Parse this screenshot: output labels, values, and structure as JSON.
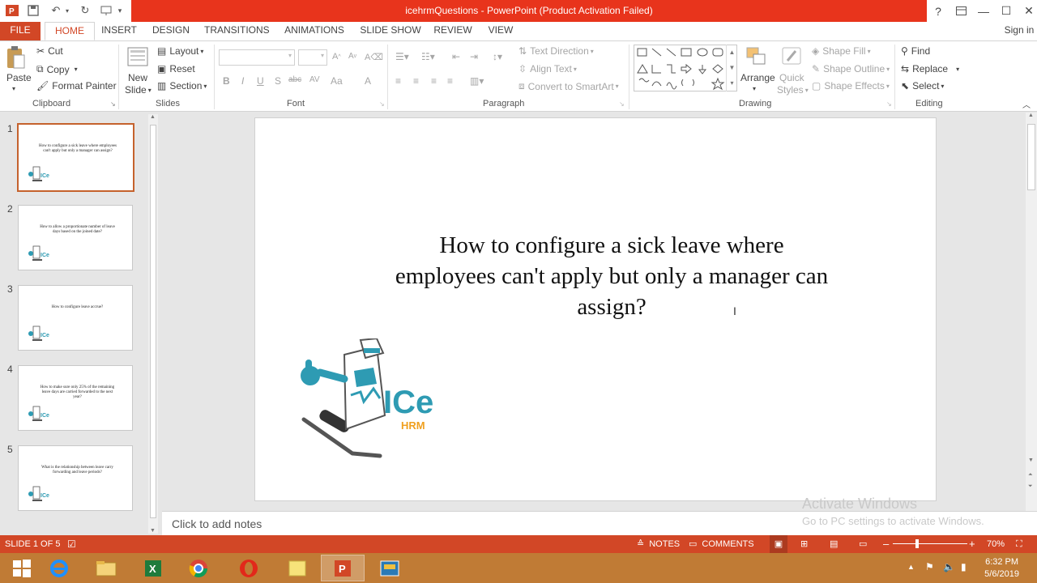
{
  "window": {
    "title": "icehrmQuestions -  PowerPoint (Product Activation Failed)",
    "help": "?",
    "sign_in": "Sign in"
  },
  "tabs": [
    "FILE",
    "HOME",
    "INSERT",
    "DESIGN",
    "TRANSITIONS",
    "ANIMATIONS",
    "SLIDE SHOW",
    "REVIEW",
    "VIEW"
  ],
  "ribbon": {
    "clipboard": {
      "paste": "Paste",
      "cut": "Cut",
      "copy": "Copy",
      "format_painter": "Format Painter",
      "label": "Clipboard"
    },
    "slides": {
      "new_slide_1": "New",
      "new_slide_2": "Slide",
      "layout": "Layout",
      "reset": "Reset",
      "section": "Section",
      "label": "Slides"
    },
    "font": {
      "label": "Font",
      "bold": "B",
      "italic": "I",
      "underline": "U",
      "shadow": "S",
      "strike": "abc",
      "spacing": "AV",
      "case": "Aa",
      "color": "A"
    },
    "paragraph": {
      "text_direction": "Text Direction",
      "align_text": "Align Text",
      "convert_smartart": "Convert to SmartArt",
      "label": "Paragraph"
    },
    "drawing": {
      "arrange": "Arrange",
      "quick_styles_1": "Quick",
      "quick_styles_2": "Styles",
      "shape_fill": "Shape Fill",
      "shape_outline": "Shape Outline",
      "shape_effects": "Shape Effects",
      "label": "Drawing"
    },
    "editing": {
      "find": "Find",
      "replace": "Replace",
      "select": "Select",
      "label": "Editing"
    }
  },
  "slides": [
    {
      "num": "1",
      "text": "How to configure a sick leave where employees can't apply but only a manager can assign?"
    },
    {
      "num": "2",
      "text": "How to allow a proportionate number of leave days based on the joined date?"
    },
    {
      "num": "3",
      "text": "How to configure leave accrue?"
    },
    {
      "num": "4",
      "text": "How to make sure only 25% of the remaining leave days are carried forwarded to the next year?"
    },
    {
      "num": "5",
      "text": "What is the relationship between leave carry forwarding and leave periods?"
    }
  ],
  "main_slide": {
    "title": "How to configure a sick leave where employees can't apply but only a manager can assign?",
    "logo_text": "ICe",
    "logo_sub": "HRM"
  },
  "notes_placeholder": "Click to add notes",
  "watermark": {
    "line1": "Activate Windows",
    "line2": "Go to PC settings to activate Windows."
  },
  "status": {
    "slide": "SLIDE 1 OF 5",
    "notes": "NOTES",
    "comments": "COMMENTS",
    "zoom": "70%"
  },
  "clock": {
    "time": "6:32 PM",
    "date": "5/6/2019"
  },
  "colors": {
    "accent": "#d24726",
    "title_bar": "#e8341c",
    "taskbar": "#c07b35"
  }
}
